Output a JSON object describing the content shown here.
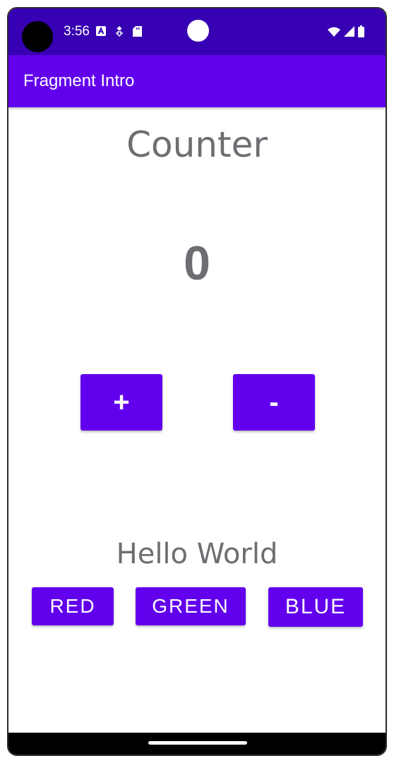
{
  "status_bar": {
    "time": "3:56",
    "left_icons": [
      "a-badge-icon",
      "data-saver-icon",
      "sd-card-icon"
    ],
    "right_icons": [
      "wifi-icon",
      "cell-signal-icon",
      "battery-icon"
    ],
    "background": "#3700b3"
  },
  "app_bar": {
    "title": "Fragment Intro",
    "background": "#6200ee"
  },
  "counter": {
    "title": "Counter",
    "value": "0",
    "increment_label": "+",
    "decrement_label": "-"
  },
  "greeting": {
    "text": "Hello World"
  },
  "color_buttons": {
    "red_label": "RED",
    "green_label": "GREEN",
    "blue_label": "BLUE"
  },
  "colors": {
    "accent": "#6200ee",
    "text_gray": "#6d6d72"
  }
}
